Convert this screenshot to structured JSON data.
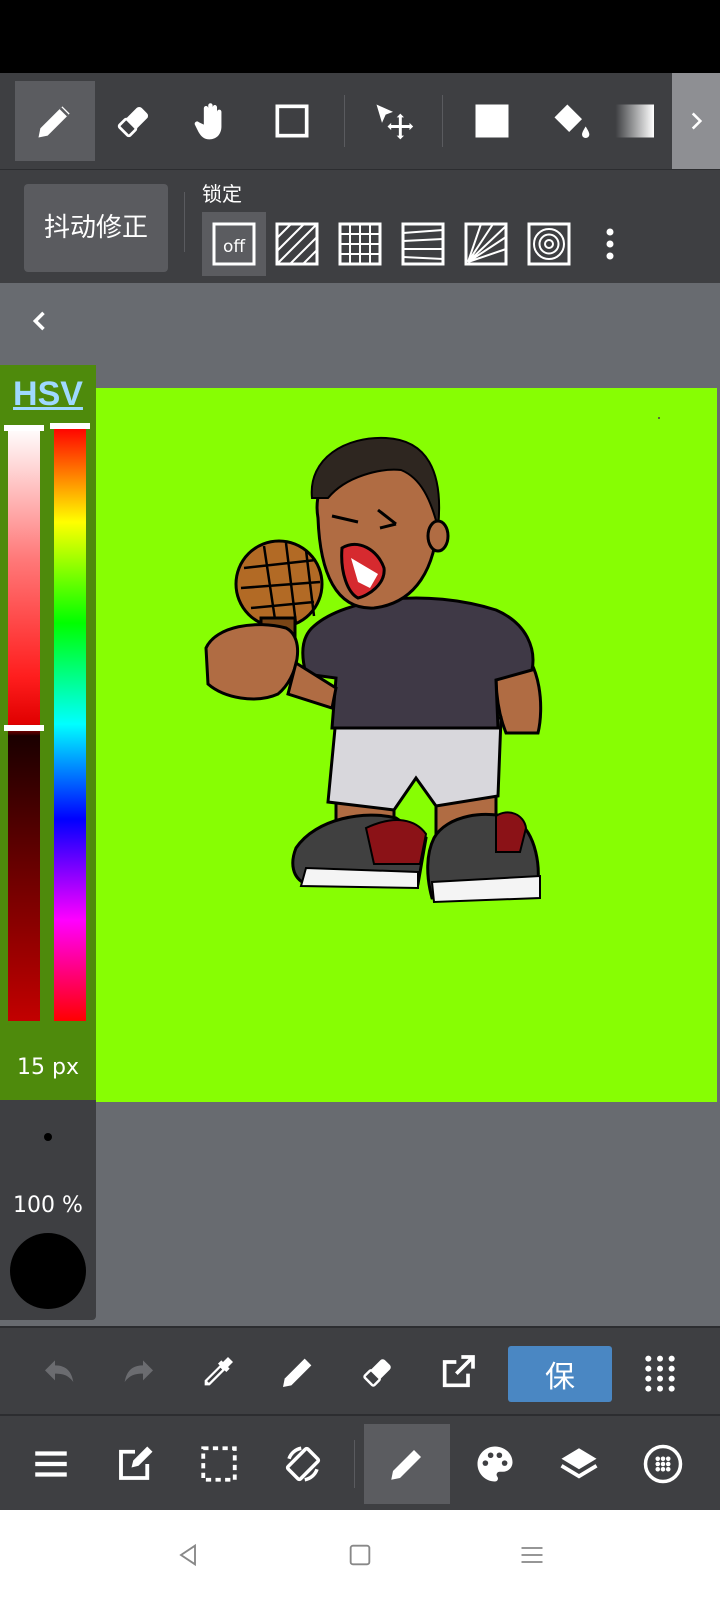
{
  "toolbar": {
    "tools": [
      "pen-tool",
      "eraser-tool",
      "hand-tool",
      "rectangle-select-tool",
      "move-tool",
      "fill-rect-tool",
      "bucket-fill-tool",
      "gradient-tool"
    ],
    "active_tool": "pen-tool"
  },
  "subbar": {
    "stabilizer_label": "抖动修正",
    "lock_label": "锁定",
    "lock_off_label": "off"
  },
  "color_panel": {
    "mode_label": "HSV",
    "brush_size_label": "15 px",
    "opacity_label": "100 %",
    "current_color": "#000000",
    "value_slider_level": 0.52,
    "hue_slider_level": 0.0
  },
  "artboard": {
    "background_color": "#87fe03"
  },
  "bottom_actions": {
    "save_label": "保"
  },
  "colors": {
    "panel": "#3e3f42",
    "active": "#5b5c60",
    "accent": "#4a87c3",
    "canvas_bg": "#686b70"
  }
}
